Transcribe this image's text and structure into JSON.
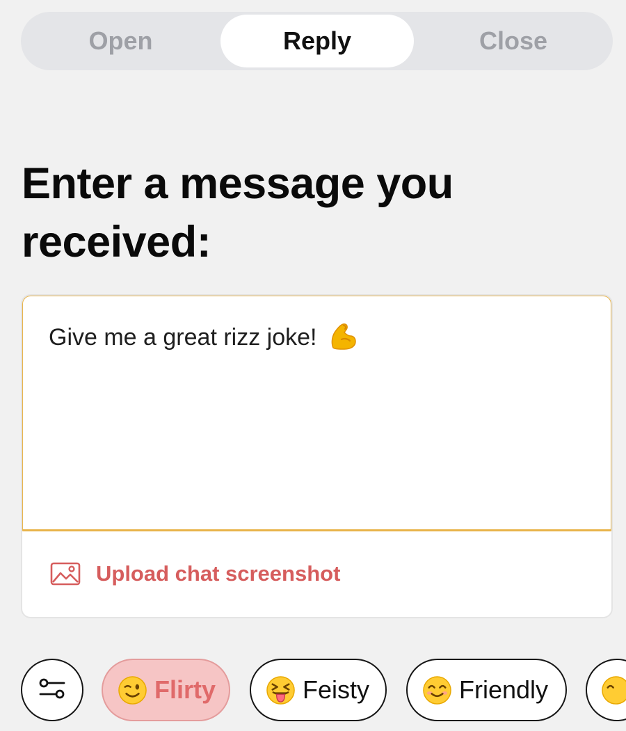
{
  "tabs": [
    {
      "label": "Open",
      "active": false
    },
    {
      "label": "Reply",
      "active": true
    },
    {
      "label": "Close",
      "active": false
    }
  ],
  "heading": "Enter a message you received:",
  "message": {
    "value": "Give me a great rizz joke!",
    "emoji_icon": "flexed-biceps-icon"
  },
  "upload": {
    "label": "Upload chat screenshot",
    "icon": "image-icon"
  },
  "tones": {
    "settings_icon": "sliders-icon",
    "chips": [
      {
        "label": "Flirty",
        "icon": "winking-face-icon",
        "selected": true
      },
      {
        "label": "Feisty",
        "icon": "squinting-tongue-face-icon",
        "selected": false
      },
      {
        "label": "Friendly",
        "icon": "smiling-face-icon",
        "selected": false
      }
    ]
  },
  "colors": {
    "accent_border": "#e8b44a",
    "upload_text": "#d65d5d",
    "selected_chip_bg": "#f6c5c5",
    "selected_chip_text": "#e06a6a"
  }
}
